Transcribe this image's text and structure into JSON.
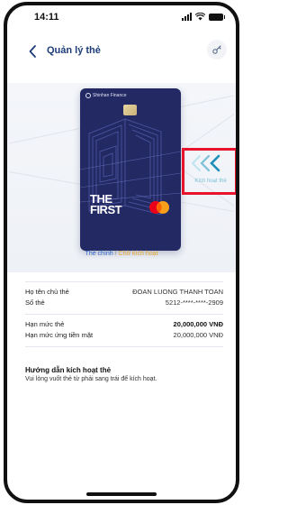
{
  "status_bar": {
    "time": "14:11"
  },
  "header": {
    "title": "Quản lý thẻ"
  },
  "card": {
    "issuer_logo": "Shinhan Finance",
    "brand_line1": "THE",
    "brand_line2": "FIRST"
  },
  "swipe": {
    "label": "Kích hoạt thẻ"
  },
  "card_status": {
    "main": "Thẻ chính",
    "separator": "/",
    "pending": "Chờ kích hoạt"
  },
  "info": {
    "rows_top": [
      {
        "label": "Họ tên chủ thẻ",
        "value": "ĐOAN LUONG THANH TOAN"
      },
      {
        "label": "Số thẻ",
        "value": "5212-****-****-2909"
      }
    ],
    "rows_bottom": [
      {
        "label": "Hạn mức thẻ",
        "value": "20,000,000 VNĐ"
      },
      {
        "label": "Hạn mức ứng tiền mặt",
        "value": "20,000,000 VNĐ"
      }
    ]
  },
  "guide": {
    "title": "Hướng dẫn kích hoạt thẻ",
    "text": "Vui lòng vuốt thẻ từ phải sang trái để kích hoạt."
  },
  "colors": {
    "title_blue": "#1c3d78",
    "card_navy": "#232a63",
    "highlight_red": "#e8142d",
    "link_blue": "#2f63c9",
    "pending_orange": "#e6a62b",
    "swipe_cyan": "#7cc0d8"
  },
  "icons": {
    "back": "chevron-left-icon",
    "settings": "card-settings-icon",
    "swipe": "double-chevron-left-icon",
    "network": "mastercard-logo"
  }
}
